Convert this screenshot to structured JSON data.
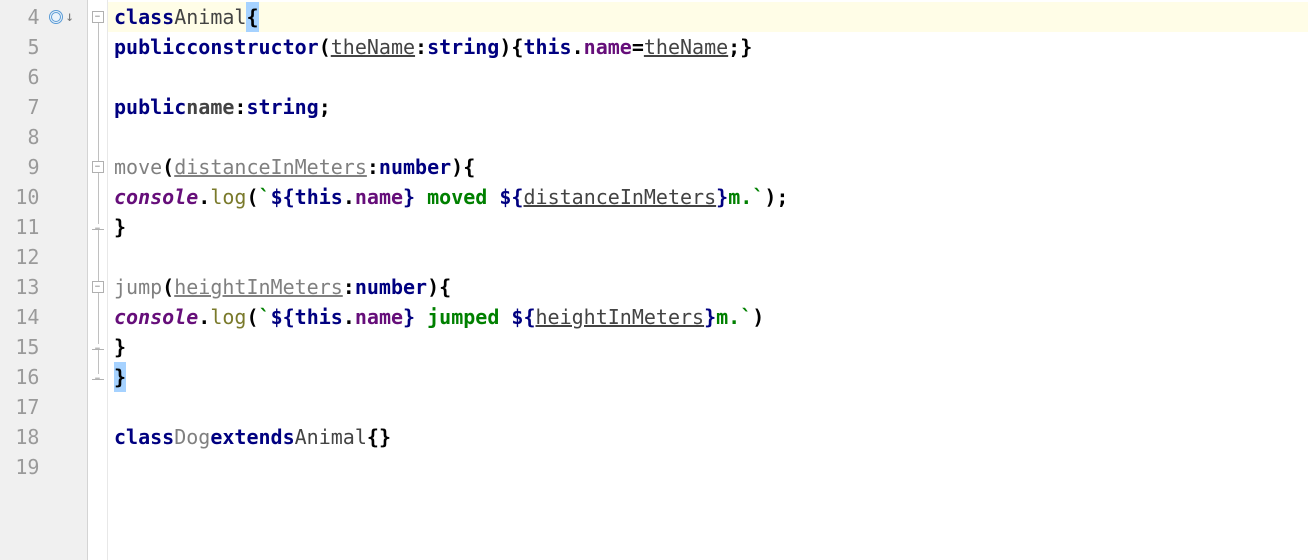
{
  "lines": {
    "start": 4,
    "end": 19
  },
  "code": {
    "l4": {
      "kw_class": "class",
      "name": "Animal",
      "brace": "{"
    },
    "l5": {
      "kw_public": "public",
      "kw_constructor": "constructor",
      "paren_o": "(",
      "param": "theName",
      "colon": ":",
      "type": "string",
      "paren_c": ")",
      "brace_o": "{",
      "this": "this",
      "dot": ".",
      "field": "name",
      "eq": "=",
      "arg": "theName",
      "semi": ";",
      "brace_c": "}"
    },
    "l7": {
      "kw_public": "public",
      "field": "name",
      "colon": ":",
      "type": "string",
      "semi": ";"
    },
    "l9": {
      "method": "move",
      "paren_o": "(",
      "param": "distanceInMeters",
      "colon": ":",
      "type": "number",
      "paren_c": ")",
      "brace_o": "{"
    },
    "l10": {
      "obj": "console",
      "dot": ".",
      "method": "log",
      "paren_o": "(",
      "btick1": "`",
      "tmpl_o1": "${",
      "this": "this",
      "dot2": ".",
      "field": "name",
      "tmpl_c1": "}",
      "txt1": " moved ",
      "tmpl_o2": "${",
      "param": "distanceInMeters",
      "tmpl_c2": "}",
      "txt2": "m.",
      "btick2": "`",
      "paren_c": ")",
      "semi": ";"
    },
    "l11": {
      "brace_c": "}"
    },
    "l13": {
      "method": "jump",
      "paren_o": "(",
      "param": "heightInMeters",
      "colon": ":",
      "type": "number",
      "paren_c": ")",
      "brace_o": "{"
    },
    "l14": {
      "obj": "console",
      "dot": ".",
      "method": "log",
      "paren_o": "(",
      "btick1": "`",
      "tmpl_o1": "${",
      "this": "this",
      "dot2": ".",
      "field": "name",
      "tmpl_c1": "}",
      "txt1": " jumped ",
      "tmpl_o2": "${",
      "param": "heightInMeters",
      "tmpl_c2": "}",
      "txt2": "m.",
      "btick2": "`",
      "paren_c": ")"
    },
    "l15": {
      "brace_c": "}"
    },
    "l16": {
      "brace_c": "}"
    },
    "l18": {
      "kw_class": "class",
      "name": "Dog",
      "kw_extends": "extends",
      "super": "Animal",
      "brace_o": "{",
      "brace_c": "}"
    }
  },
  "gutter": {
    "n4": "4",
    "n5": "5",
    "n6": "6",
    "n7": "7",
    "n8": "8",
    "n9": "9",
    "n10": "10",
    "n11": "11",
    "n12": "12",
    "n13": "13",
    "n14": "14",
    "n15": "15",
    "n16": "16",
    "n17": "17",
    "n18": "18",
    "n19": "19"
  },
  "fold": {
    "minus": "−"
  }
}
